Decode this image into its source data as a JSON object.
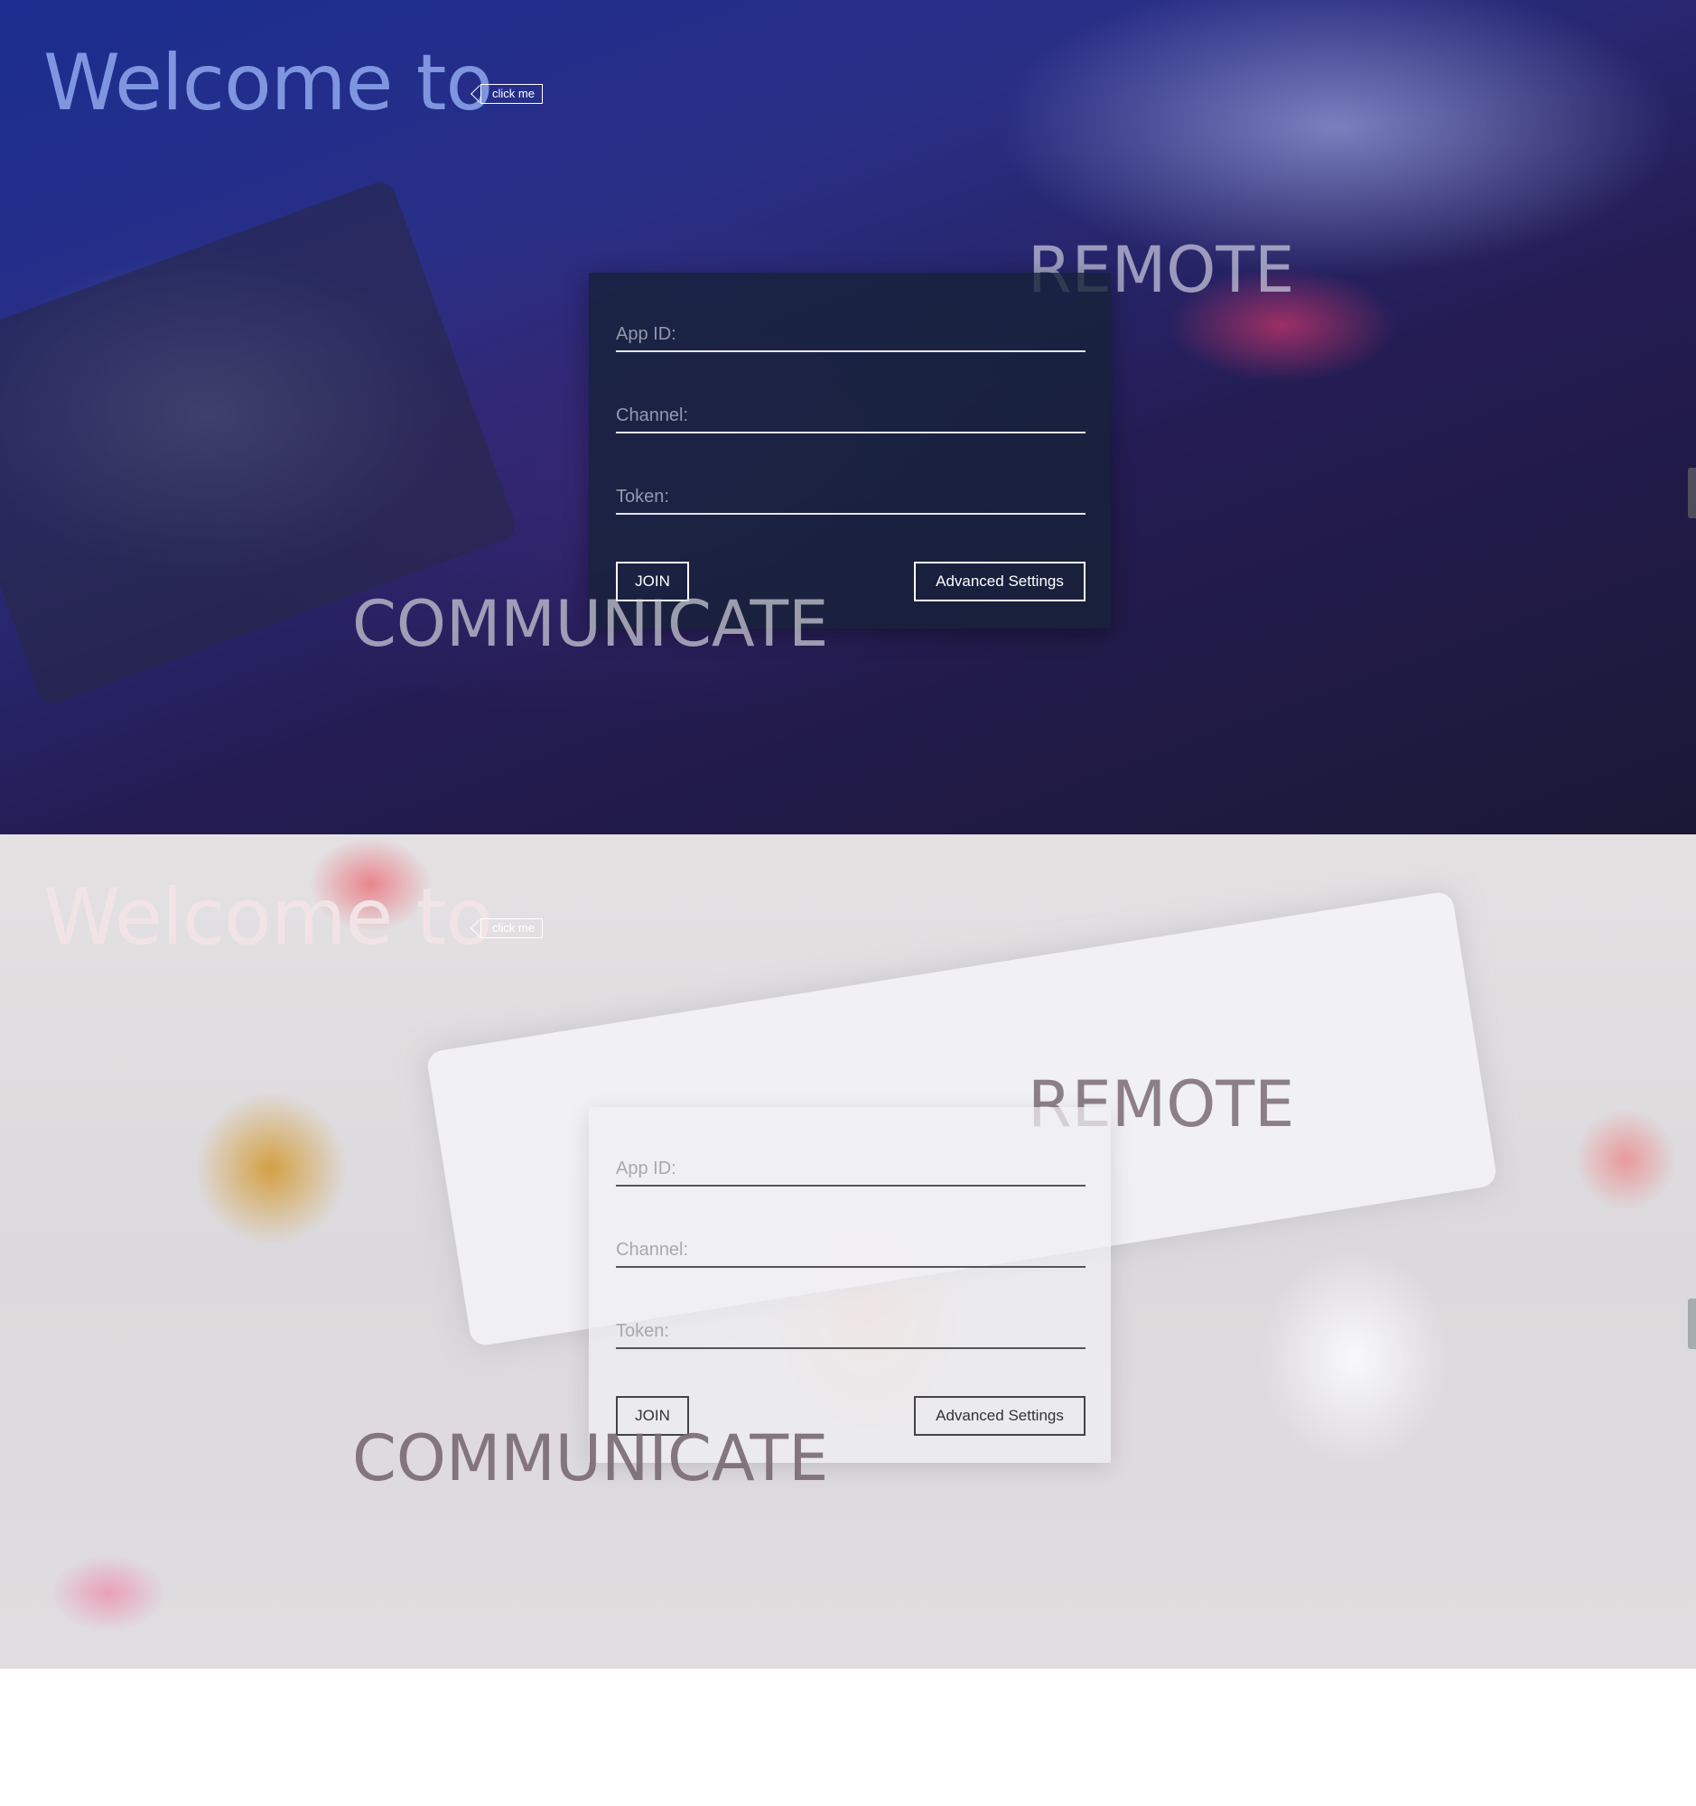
{
  "panels": [
    {
      "theme": "dark",
      "welcome": "Welcome to",
      "click_me": "click me",
      "remote": "REMOTE",
      "communicate": "COMMUNICATE",
      "form": {
        "app_id_placeholder": "App ID:",
        "channel_placeholder": "Channel:",
        "token_placeholder": "Token:",
        "join_label": "JOIN",
        "advanced_label": "Advanced Settings"
      }
    },
    {
      "theme": "light",
      "welcome": "Welcome to",
      "click_me": "click me",
      "remote": "REMOTE",
      "communicate": "COMMUNICATE",
      "form": {
        "app_id_placeholder": "App ID:",
        "channel_placeholder": "Channel:",
        "token_placeholder": "Token:",
        "join_label": "JOIN",
        "advanced_label": "Advanced Settings"
      }
    }
  ],
  "colors": {
    "dark_title": "#7f95e0",
    "light_title": "#f2e4e6",
    "dark_card": "#162238",
    "light_card": "#f0f0f3"
  },
  "icons": [
    "chevron-left-icon"
  ]
}
